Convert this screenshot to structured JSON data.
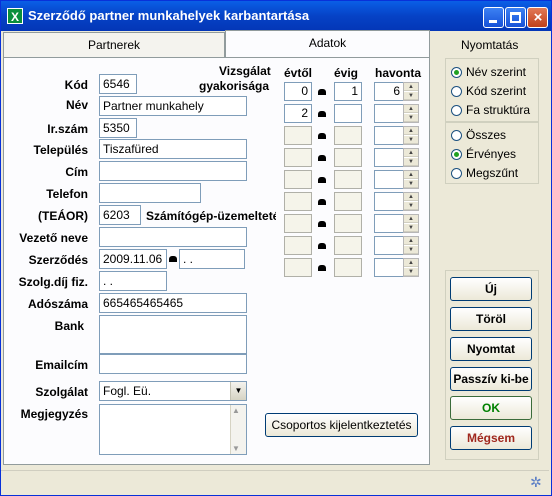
{
  "window": {
    "title": "Szerződő partner munkahelyek karbantartása",
    "app_icon": "X"
  },
  "tabs": [
    {
      "label": "Partnerek"
    },
    {
      "label": "Adatok"
    }
  ],
  "form": {
    "kod_label": "Kód",
    "kod_value": "6546",
    "nev_label": "Név",
    "nev_value": "Partner munkahely",
    "irszam_label": "Ir.szám",
    "irszam_value": "5350",
    "telepules_label": "Település",
    "telepules_value": "Tiszafüred",
    "cim_label": "Cím",
    "cim_value": "",
    "telefon_label": "Telefon",
    "telefon_value": "",
    "teaor_label": "(TEÁOR)",
    "teaor_code": "6203",
    "teaor_text": "Számítógép-üzemeltetés",
    "vezeto_label": "Vezető neve",
    "vezeto_value": "",
    "szerzodes_label": "Szerződés",
    "szerzodes_from": "2009.11.06",
    "szerzodes_to": " . .",
    "szolgdij_label": "Szolg.díj fiz.",
    "szolgdij_value": " . .",
    "adoszam_label": "Adószáma",
    "adoszam_value": "665465465465",
    "bank_label": "Bank",
    "bank_value": "",
    "email_label": "Emailcím",
    "email_value": "",
    "szolgalat_label": "Szolgálat",
    "szolgalat_value": "Fogl. Eü.",
    "megjegyzes_label": "Megjegyzés",
    "megjegyzes_value": ""
  },
  "vizsgalat": {
    "title_line1": "Vizsgálat",
    "title_line2": "gyakorisága",
    "col_evtol": "évtől",
    "col_evig": "évig",
    "col_havonta": "havonta",
    "rows": [
      {
        "evtol": "0",
        "evig": "1",
        "havonta": "6"
      },
      {
        "evtol": "2",
        "evig": "",
        "havonta": ""
      },
      {
        "evtol": "",
        "evig": "",
        "havonta": ""
      },
      {
        "evtol": "",
        "evig": "",
        "havonta": ""
      },
      {
        "evtol": "",
        "evig": "",
        "havonta": ""
      },
      {
        "evtol": "",
        "evig": "",
        "havonta": ""
      },
      {
        "evtol": "",
        "evig": "",
        "havonta": ""
      },
      {
        "evtol": "",
        "evig": "",
        "havonta": ""
      },
      {
        "evtol": "",
        "evig": "",
        "havonta": ""
      }
    ]
  },
  "group_button": "Csoportos kijelentkeztetés",
  "print_panel": {
    "title": "Nyomtatás",
    "sort_options": [
      "Név szerint",
      "Kód szerint",
      "Fa struktúra"
    ],
    "sort_selected": 0,
    "filter_options": [
      "Összes",
      "Érvényes",
      "Megszűnt"
    ],
    "filter_selected": 1
  },
  "buttons": {
    "new": "Új",
    "delete": "Töröl",
    "print": "Nyomtat",
    "passive": "Passzív ki-be",
    "ok": "OK",
    "cancel": "Mégsem"
  },
  "colors": {
    "ok": "#008000",
    "cancel": "#a0281e",
    "title_bar": "#0642c6"
  }
}
